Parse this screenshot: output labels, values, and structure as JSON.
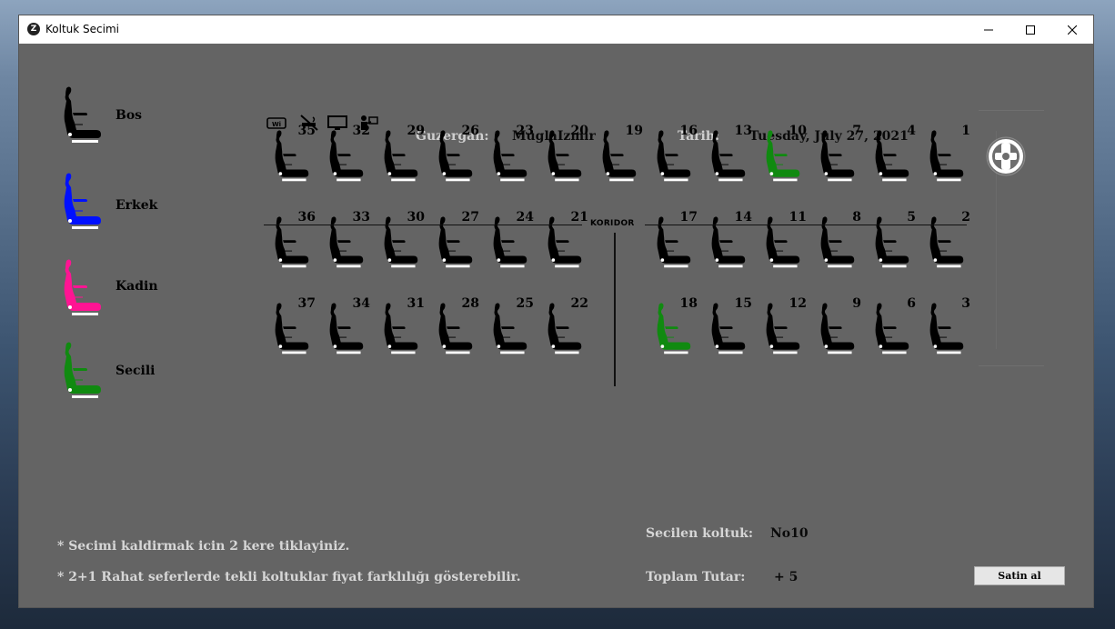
{
  "window": {
    "title": "Koltuk Secimi",
    "app_icon_letter": "Z"
  },
  "legend": [
    {
      "label": "Bos",
      "color": "#000000"
    },
    {
      "label": "Erkek",
      "color": "#0010ff"
    },
    {
      "label": "Kadin",
      "color": "#ff1493"
    },
    {
      "label": "Secili",
      "color": "#108a10"
    }
  ],
  "amenities": [
    "wifi-icon",
    "no-smoking-icon",
    "tv-icon",
    "attendant-icon"
  ],
  "header": {
    "route_label": "Guzergah:",
    "route_value": "MuglaIzmir",
    "date_label": "Tarih:",
    "date_value": "Tuesday, July 27, 2021"
  },
  "corridor_label": "KORIDOR",
  "seat_rows": [
    [
      "35",
      "32",
      "29",
      "26",
      "23",
      "20",
      "19",
      "16",
      "13",
      "10",
      "7",
      "4",
      "1"
    ],
    [
      "36",
      "33",
      "30",
      "27",
      "24",
      "21",
      "",
      "17",
      "14",
      "11",
      "8",
      "5",
      "2"
    ],
    [
      "37",
      "34",
      "31",
      "28",
      "25",
      "22",
      "",
      "18",
      "15",
      "12",
      "9",
      "6",
      "3"
    ]
  ],
  "selected_seats": [
    "10",
    "18"
  ],
  "selected_color": "#108a10",
  "empty_color": "#000000",
  "notes": [
    "* Secimi kaldirmak icin 2 kere tiklayiniz.",
    "* 2+1 Rahat seferlerde tekli koltuklar fiyat farklılığı gösterebilir."
  ],
  "summary": {
    "seat_label": "Secilen koltuk:",
    "seat_value": "No10",
    "total_label": "Toplam Tutar:",
    "total_value": "+ 5"
  },
  "buy_button": "Satin al"
}
